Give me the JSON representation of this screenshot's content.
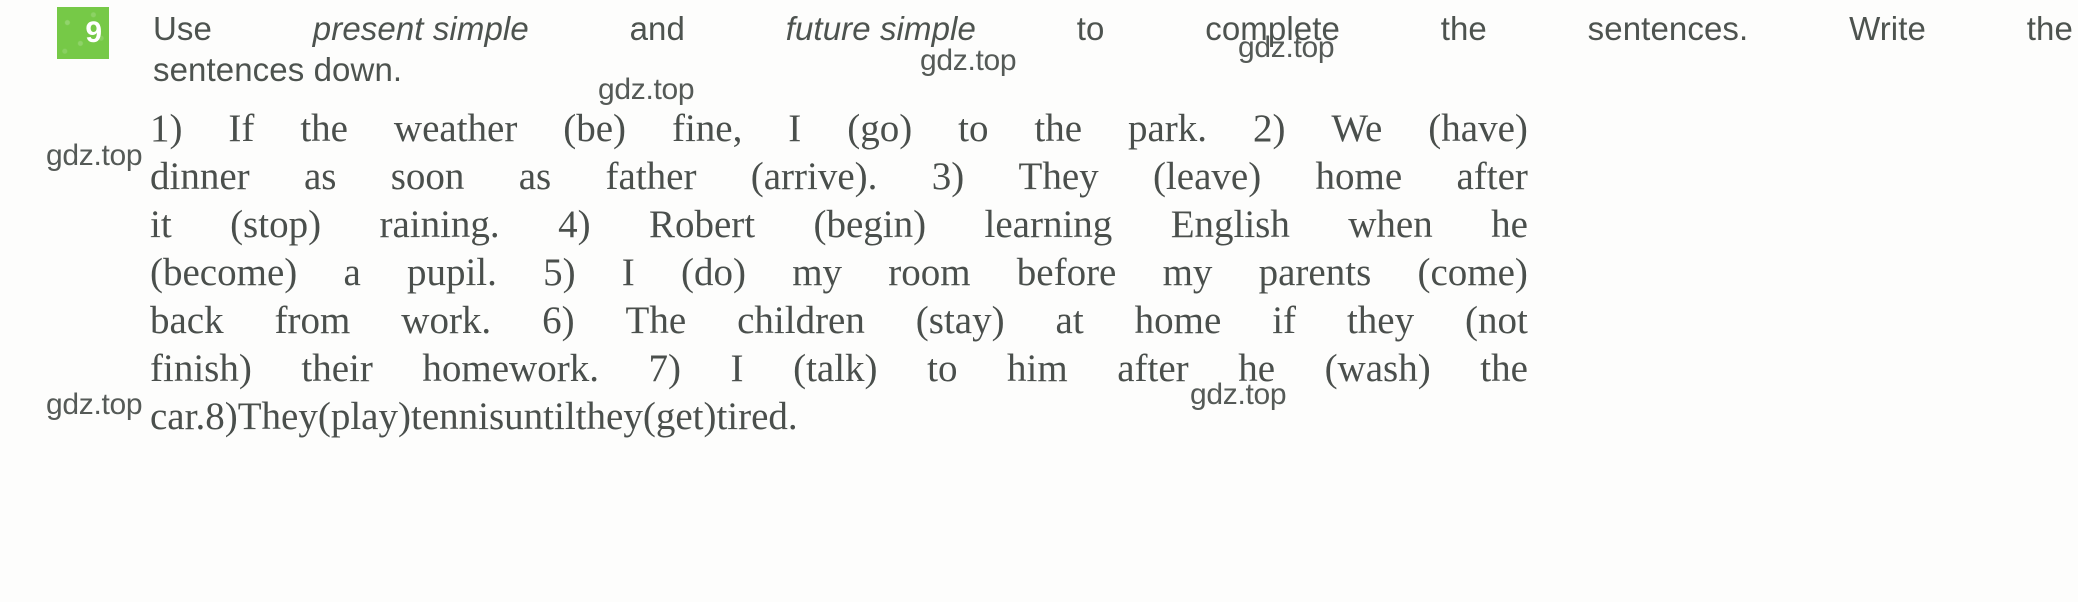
{
  "exercise": {
    "number": "9",
    "badge_color": "#76c947",
    "badge_text_color": "#ffffff"
  },
  "instruction": {
    "line1": {
      "words": [
        {
          "t": "Use",
          "i": false
        },
        {
          "t": "present simple",
          "i": true
        },
        {
          "t": "and",
          "i": false
        },
        {
          "t": "future simple",
          "i": true
        },
        {
          "t": "to",
          "i": false
        },
        {
          "t": "complete",
          "i": false
        },
        {
          "t": "the",
          "i": false
        },
        {
          "t": "sentences.",
          "i": false
        },
        {
          "t": "Write",
          "i": false
        },
        {
          "t": "the",
          "i": false
        }
      ]
    },
    "line2": "sentences  down.",
    "full_text": "Use present simple and future simple to complete the sentences. Write the sentences down."
  },
  "sentences": {
    "full_text": "1) If the weather (be) fine, I (go) to the park. 2) We (have) dinner as soon as father (arrive). 3) They (leave) home after it (stop) raining. 4) Robert (begin) learning English when he (become) a pupil. 5) I (do) my room before my parents (come) back from work. 6) The children (stay) at home if they (not finish) their homework. 7) I (talk) to him after he (wash) the car. 8) They (play) tennis until they (get) tired.",
    "lines": [
      [
        "1)",
        "If",
        "the",
        "weather",
        "(be)",
        "fine,",
        "I",
        "(go)",
        "to",
        "the",
        "park.",
        "2)",
        "We",
        "(have)"
      ],
      [
        "dinner",
        "as",
        "soon",
        "as",
        "father",
        "(arrive).",
        "3)",
        "They",
        "(leave)",
        "home",
        "after"
      ],
      [
        "it",
        "(stop)",
        "raining.",
        "4)",
        "Robert",
        "(begin)",
        "learning",
        "English",
        "when",
        "he"
      ],
      [
        "(become)",
        "a",
        "pupil.",
        "5)",
        "I",
        "(do)",
        "my",
        "room",
        "before",
        "my",
        "parents",
        "(come)"
      ],
      [
        "back",
        "from",
        "work.",
        "6)",
        "The",
        "children",
        "(stay)",
        "at",
        "home",
        "if",
        "they",
        "(not"
      ],
      [
        "finish)",
        "their",
        "homework.",
        "7)",
        "I",
        "(talk)",
        "to",
        "him",
        "after",
        "he",
        "(wash)",
        "the"
      ],
      [
        "car.",
        "8)",
        "They",
        "(play)",
        "tennis",
        "until",
        "they",
        "(get)",
        "tired."
      ]
    ],
    "items": [
      {
        "n": "1)",
        "text": "If the weather (be) fine, I (go) to the park."
      },
      {
        "n": "2)",
        "text": "We (have) dinner as soon as father (arrive)."
      },
      {
        "n": "3)",
        "text": "They (leave) home after it (stop) raining."
      },
      {
        "n": "4)",
        "text": "Robert (begin) learning English when he (become) a pupil."
      },
      {
        "n": "5)",
        "text": "I (do) my room before my parents (come) back from work."
      },
      {
        "n": "6)",
        "text": "The children (stay) at home if they (not finish) their homework."
      },
      {
        "n": "7)",
        "text": "I (talk) to him after he (wash) the car."
      },
      {
        "n": "8)",
        "text": "They (play) tennis until they (get) tired."
      }
    ]
  },
  "watermarks": {
    "text": "gdz.top",
    "count": 6,
    "items": [
      "gdz.top",
      "gdz.top",
      "gdz.top",
      "gdz.top",
      "gdz.top",
      "gdz.top"
    ]
  }
}
